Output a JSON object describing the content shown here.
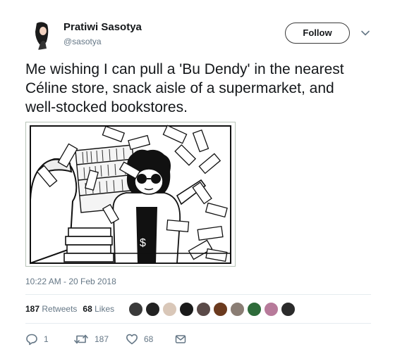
{
  "user": {
    "name": "Pratiwi Sasotya",
    "handle": "@sasotya"
  },
  "follow_label": "Follow",
  "tweet": {
    "text": "Me wishing I can pull a 'Bu Dendy' in the nearest Céline store, snack aisle of a supermarket, and well-stocked bookstores."
  },
  "timestamp": "10:22 AM - 20 Feb 2018",
  "stats": {
    "retweets_count": "187",
    "retweets_label": "Retweets",
    "likes_count": "68",
    "likes_label": "Likes"
  },
  "actions": {
    "reply_count": "1",
    "retweet_count": "187",
    "like_count": "68"
  },
  "icons": {
    "caret": "chevron-down-icon",
    "reply": "reply-icon",
    "retweet": "retweet-icon",
    "like": "heart-icon",
    "dm": "envelope-icon"
  },
  "colors": {
    "text": "#14171a",
    "muted": "#657786",
    "divider": "#e6ecf0"
  }
}
